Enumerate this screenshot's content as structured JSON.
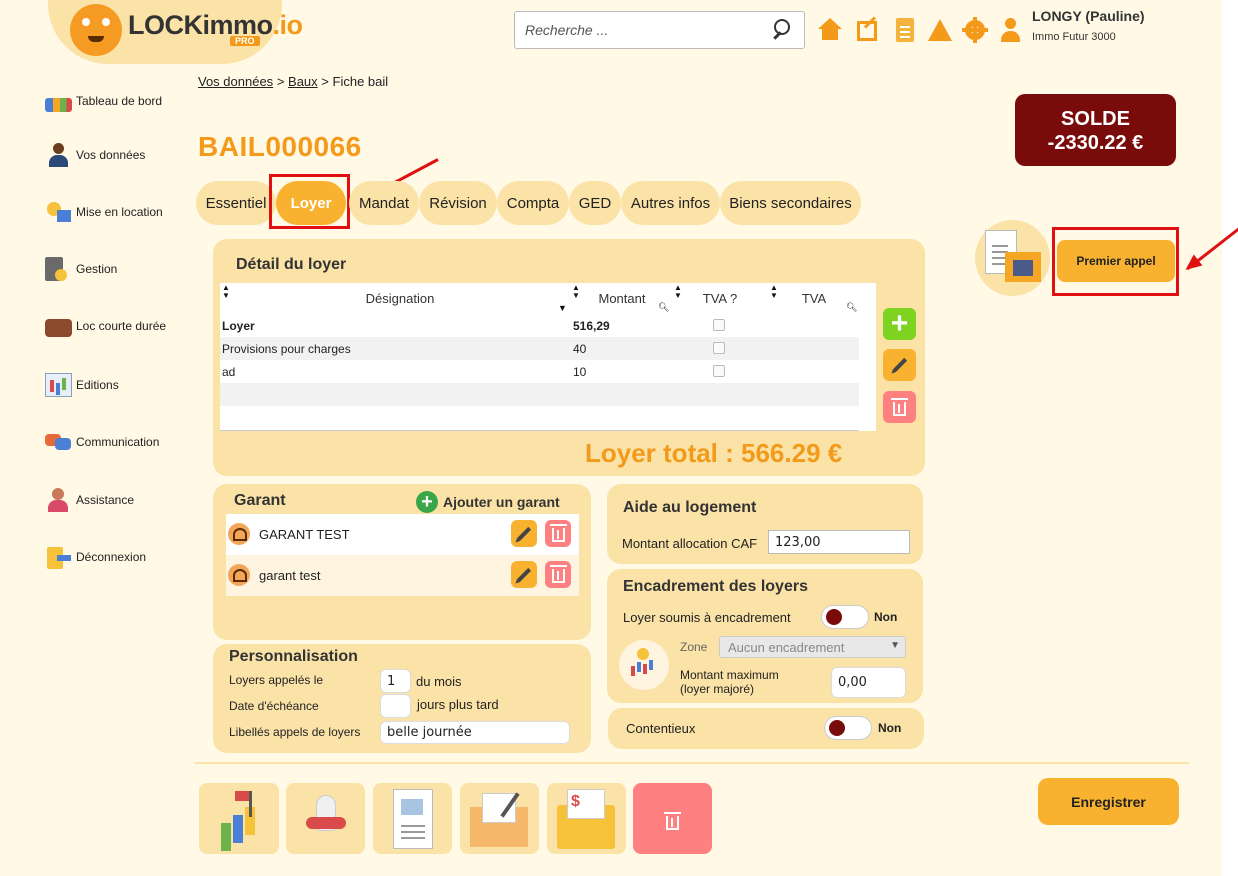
{
  "header": {
    "logo_text_main": "LOCKimmo",
    "logo_text_suffix": ".io",
    "logo_badge": "PRO",
    "search_placeholder": "Recherche ...",
    "user_name": "LONGY (Pauline)",
    "user_agency": "Immo Futur 3000",
    "icons": [
      "home-icon",
      "external-link-icon",
      "document-icon",
      "tent-icon",
      "gear-icon",
      "user-icon"
    ],
    "accent_color": "#f39a1b"
  },
  "sidebar": {
    "items": [
      {
        "label": "Tableau de bord",
        "icon": "dashboard-icon"
      },
      {
        "label": "Vos données",
        "icon": "person-icon"
      },
      {
        "label": "Mise en location",
        "icon": "key-house-icon"
      },
      {
        "label": "Gestion",
        "icon": "calculator-icon"
      },
      {
        "label": "Loc courte durée",
        "icon": "suitcase-icon"
      },
      {
        "label": "Editions",
        "icon": "report-icon"
      },
      {
        "label": "Communication",
        "icon": "chat-icon"
      },
      {
        "label": "Assistance",
        "icon": "support-agent-icon"
      },
      {
        "label": "Déconnexion",
        "icon": "logout-icon"
      }
    ]
  },
  "breadcrumb": {
    "item1": "Vos données",
    "sep": ">",
    "item2": "Baux",
    "current": "Fiche bail"
  },
  "bail": {
    "id": "BAIL000066"
  },
  "solde": {
    "label": "SOLDE",
    "value": "-2330.22 €",
    "color": "#7a0b0b"
  },
  "tabs": [
    {
      "label": "Essentiel",
      "active": false
    },
    {
      "label": "Loyer",
      "active": true
    },
    {
      "label": "Mandat",
      "active": false
    },
    {
      "label": "Révision",
      "active": false
    },
    {
      "label": "Compta",
      "active": false
    },
    {
      "label": "GED",
      "active": false
    },
    {
      "label": "Autres infos",
      "active": false
    },
    {
      "label": "Biens secondaires",
      "active": false
    }
  ],
  "actions": {
    "premier_appel": "Premier appel"
  },
  "loyer_detail": {
    "title": "Détail du loyer",
    "columns": [
      "Désignation",
      "Montant",
      "TVA ?",
      "TVA"
    ],
    "rows": [
      {
        "designation": "Loyer",
        "montant": "516,29",
        "bold": true
      },
      {
        "designation": "Provisions pour charges",
        "montant": "40",
        "bold": false
      },
      {
        "designation": "ad",
        "montant": "10",
        "bold": false
      }
    ],
    "total_label": "Loyer total : 566.29 €"
  },
  "garant": {
    "title": "Garant",
    "add_label": "Ajouter un garant",
    "items": [
      "GARANT TEST",
      "garant test"
    ]
  },
  "aide": {
    "title": "Aide au logement",
    "caf_label": "Montant allocation CAF",
    "caf_value": "123,00"
  },
  "encadrement": {
    "title": "Encadrement des loyers",
    "soumis_label": "Loyer soumis à encadrement",
    "soumis_value": "Non",
    "zone_label": "Zone",
    "zone_value": "Aucun encadrement",
    "max_label_1": "Montant maximum",
    "max_label_2": "(loyer majoré)",
    "max_value": "0,00"
  },
  "contentieux": {
    "label": "Contentieux",
    "value": "Non"
  },
  "personnalisation": {
    "title": "Personnalisation",
    "appeles_label": "Loyers appelés le",
    "appeles_value": "1",
    "appeles_suffix": "du mois",
    "echeance_label": "Date d'échéance",
    "echeance_value": "",
    "echeance_suffix": "jours plus tard",
    "libelles_label": "Libellés appels de loyers",
    "libelles_value": "belle journée"
  },
  "footer": {
    "save_label": "Enregistrer",
    "bottom_icons": [
      "chart-flag-icon",
      "rocket-icon",
      "lease-document-icon",
      "mail-envelope-icon",
      "invoice-folder-icon",
      "trash-icon"
    ]
  }
}
